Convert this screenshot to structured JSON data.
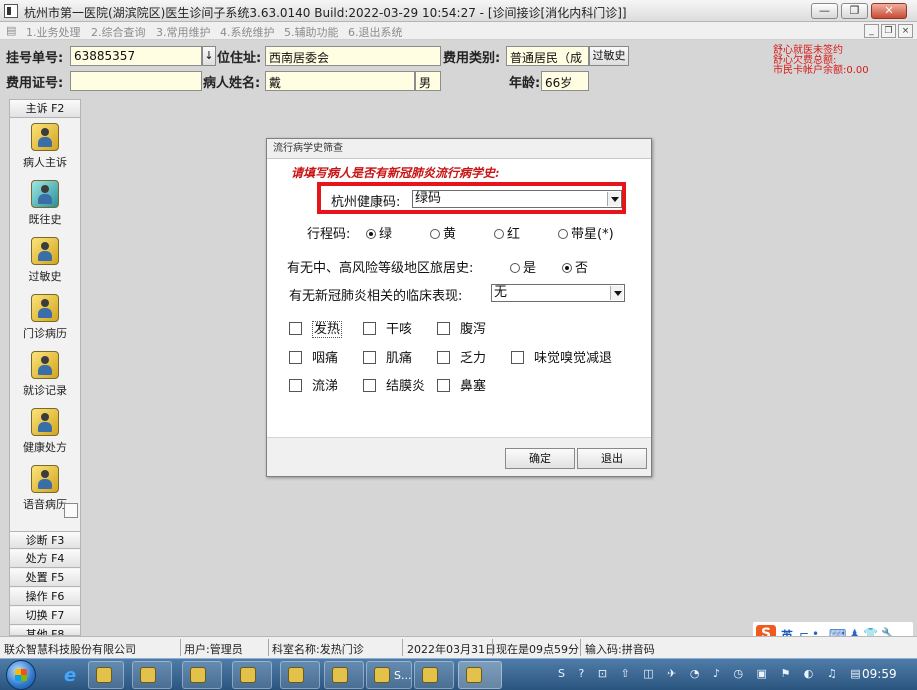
{
  "window": {
    "title": "杭州市第一医院(湖滨院区)医生诊间子系统3.63.0140  Build:2022-03-29 10:54:27 - [诊间接诊[消化内科门诊]]",
    "buttons": [
      "—",
      "❐",
      "✕"
    ]
  },
  "menu": {
    "items": [
      "1.业务处理",
      "2.综合查询",
      "3.常用维护",
      "4.系统维护",
      "5.辅助功能",
      "6.退出系统"
    ],
    "mdi_buttons": [
      "_",
      "❐",
      "×"
    ]
  },
  "patient": {
    "reg_no_label": "挂号单号:",
    "reg_no": "63885357",
    "arrow": "↓",
    "address_label": "位住址:",
    "address": "西南居委会",
    "fee_type_label": "费用类别:",
    "fee_type": "普通居民（成",
    "allergy_button": "过敏史",
    "fee_cert_label": "费用证号:",
    "fee_cert": "",
    "name_label": "病人姓名:",
    "name": "戴",
    "gender": "男",
    "age_label": "年龄:",
    "age": "66岁",
    "info_lines": [
      "舒心就医未签约",
      "舒心欠费总额:",
      "市民卡帐户余额:0.00"
    ]
  },
  "sidebar": {
    "top_tab": "主诉 F2",
    "items": [
      {
        "label": "病人主诉"
      },
      {
        "label": "既往史"
      },
      {
        "label": "过敏史"
      },
      {
        "label": "门诊病历"
      },
      {
        "label": "就诊记录"
      },
      {
        "label": "健康处方"
      },
      {
        "label": "语音病历"
      }
    ],
    "bottom_tabs": [
      "诊断 F3",
      "处方 F4",
      "处置 F5",
      "操作 F6",
      "切换 F7",
      "其他 F8"
    ]
  },
  "dialog": {
    "title": "流行病学史筛查",
    "heading": "请填写病人是否有新冠肺炎流行病学史:",
    "health_code_label": "杭州健康码:",
    "health_code_value": "绿码",
    "trip_code_label": "行程码:",
    "trip_options": [
      {
        "label": "绿",
        "checked": true
      },
      {
        "label": "黄",
        "checked": false
      },
      {
        "label": "红",
        "checked": false
      },
      {
        "label": "带星(*)",
        "checked": false
      }
    ],
    "risk_label": "有无中、高风险等级地区旅居史:",
    "risk_options": [
      {
        "label": "是",
        "checked": false
      },
      {
        "label": "否",
        "checked": true
      }
    ],
    "clinical_label": "有无新冠肺炎相关的临床表现:",
    "clinical_value": "无",
    "symptoms": [
      "发热",
      "干咳",
      "腹泻",
      "咽痛",
      "肌痛",
      "乏力",
      "味觉嗅觉减退",
      "流涕",
      "结膜炎",
      "鼻塞"
    ],
    "ok_button": "确定",
    "exit_button": "退出",
    "highlight_color": "#e8141c"
  },
  "status": {
    "company": "联众智慧科技股份有限公司",
    "user": "用户:管理员",
    "department": "科室名称:发热门诊",
    "date": "2022年03月31日",
    "time_now": "现在是09点59分",
    "input_method": "输入码:拼音码"
  },
  "ime": {
    "logo": "S",
    "mode": "英",
    "icons": "⌐•,⌨♟👕🔧"
  },
  "taskbar": {
    "app_label": "S...",
    "tray": "S ? ⊡ ⇧ ◫ ✈ ◔ ♪ ◷ ▣ ⚑ ◐ ♫ ▤",
    "clock": "09:59"
  },
  "colors": {
    "field_bg": "#fffde2",
    "alert_red": "#d61a1a",
    "heading_red": "#c81414"
  }
}
